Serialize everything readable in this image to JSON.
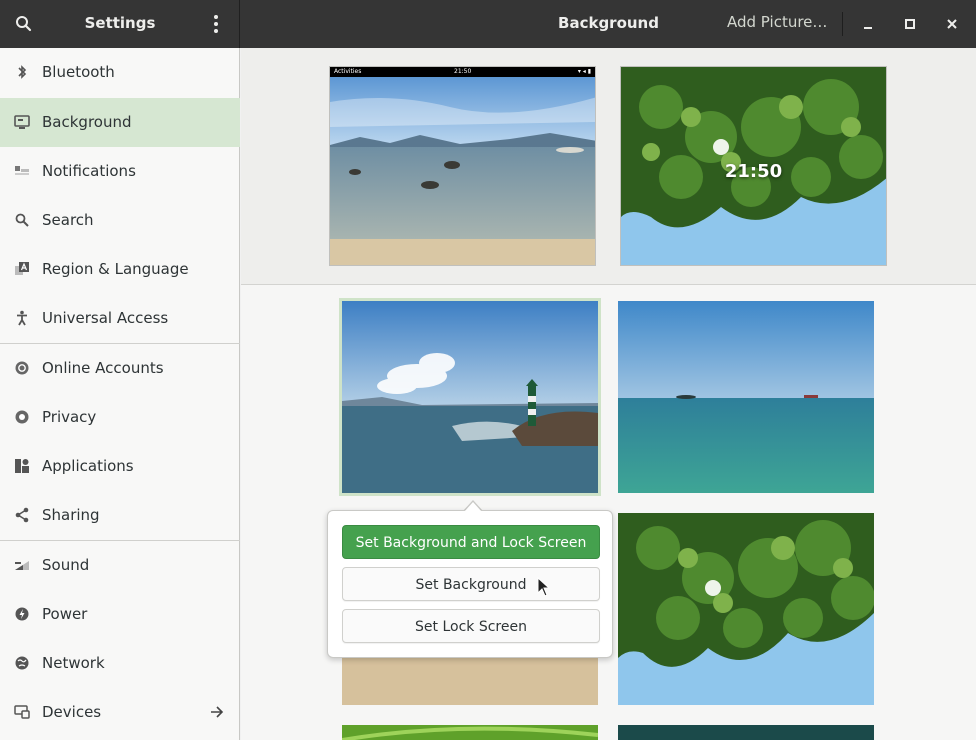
{
  "window": {
    "app_title": "Settings",
    "page_title": "Background",
    "add_picture_label": "Add Picture…"
  },
  "sidebar": {
    "items": [
      {
        "label": "Bluetooth",
        "icon": "bluetooth-icon"
      },
      {
        "label": "Background",
        "icon": "background-icon",
        "active": true
      },
      {
        "label": "Notifications",
        "icon": "notifications-icon"
      },
      {
        "label": "Search",
        "icon": "search-icon"
      },
      {
        "label": "Region & Language",
        "icon": "region-language-icon"
      },
      {
        "label": "Universal Access",
        "icon": "universal-access-icon"
      },
      {
        "label": "Online Accounts",
        "icon": "online-accounts-icon"
      },
      {
        "label": "Privacy",
        "icon": "privacy-icon"
      },
      {
        "label": "Applications",
        "icon": "applications-icon"
      },
      {
        "label": "Sharing",
        "icon": "sharing-icon"
      },
      {
        "label": "Sound",
        "icon": "sound-icon"
      },
      {
        "label": "Power",
        "icon": "power-icon"
      },
      {
        "label": "Network",
        "icon": "network-icon"
      },
      {
        "label": "Devices",
        "icon": "devices-icon"
      }
    ]
  },
  "previews": {
    "desktop": {
      "topbar_activities": "Activities",
      "topbar_clock": "21:50"
    },
    "lock_screen": {
      "clock": "21:50"
    }
  },
  "popover": {
    "primary_label": "Set Background and Lock Screen",
    "background_label": "Set Background",
    "lock_label": "Set Lock Screen"
  },
  "colors": {
    "accent": "#45a14e",
    "sidebar_active": "#d6e7d2",
    "headerbar": "#353535"
  }
}
